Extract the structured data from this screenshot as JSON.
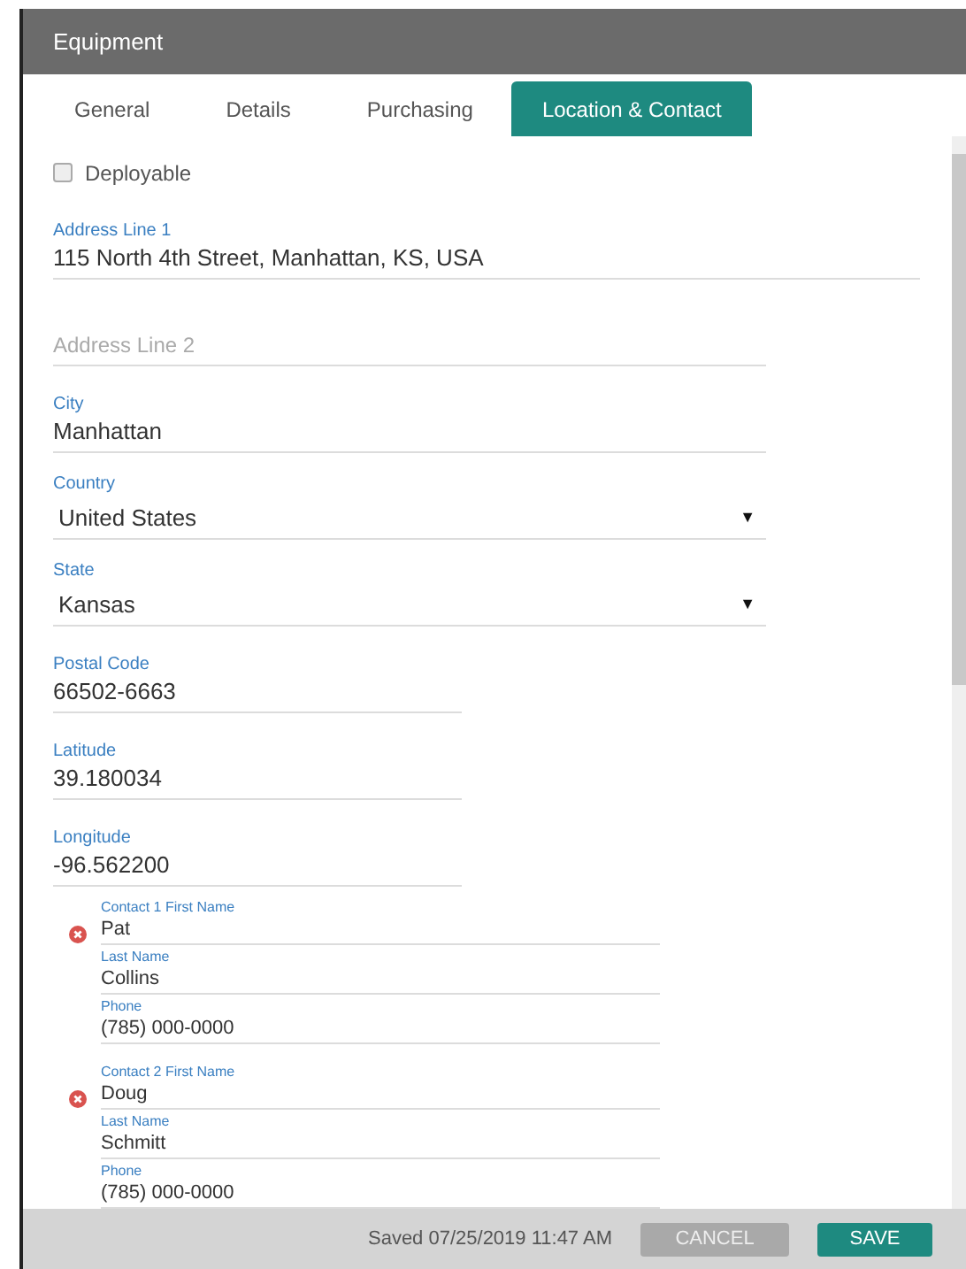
{
  "window": {
    "title": "Equipment"
  },
  "tabs": [
    {
      "label": "General",
      "selected": false
    },
    {
      "label": "Details",
      "selected": false
    },
    {
      "label": "Purchasing",
      "selected": false
    },
    {
      "label": "Location & Contact",
      "selected": true
    }
  ],
  "deployable": {
    "label": "Deployable",
    "checked": false
  },
  "fields": [
    {
      "kind": "text",
      "label": "Address Line 1",
      "value": "115 North 4th Street, Manhattan, KS, USA"
    },
    {
      "kind": "text",
      "placeholder": "Address Line 2"
    },
    {
      "kind": "text",
      "label": "City",
      "value": "Manhattan"
    },
    {
      "kind": "select",
      "label": "Country",
      "value": "United States",
      "arrow": "▼"
    },
    {
      "kind": "select",
      "label": "State",
      "value": "Kansas",
      "arrow": "▼"
    },
    {
      "kind": "text",
      "label": "Postal Code",
      "value": "66502-6663"
    },
    {
      "kind": "text",
      "label": "Latitude",
      "value": "39.180034"
    },
    {
      "kind": "text",
      "label": "Longitude",
      "value": "-96.562200"
    }
  ],
  "contacts": [
    {
      "fields": [
        {
          "label": "Contact 1 First Name",
          "value": "Pat"
        },
        {
          "label": "Last Name",
          "value": "Collins"
        },
        {
          "label": "Phone",
          "value": "(785) 000-0000"
        }
      ]
    },
    {
      "fields": [
        {
          "label": "Contact 2 First Name",
          "value": "Doug"
        },
        {
          "label": "Last Name",
          "value": "Schmitt"
        },
        {
          "label": "Phone",
          "value": "(785) 000-0000"
        }
      ]
    }
  ],
  "footer": {
    "status": "Saved 07/25/2019 11:47 AM",
    "buttons": [
      {
        "kind": "secondary",
        "label": "CANCEL"
      },
      {
        "kind": "primary",
        "label": "SAVE"
      }
    ]
  }
}
